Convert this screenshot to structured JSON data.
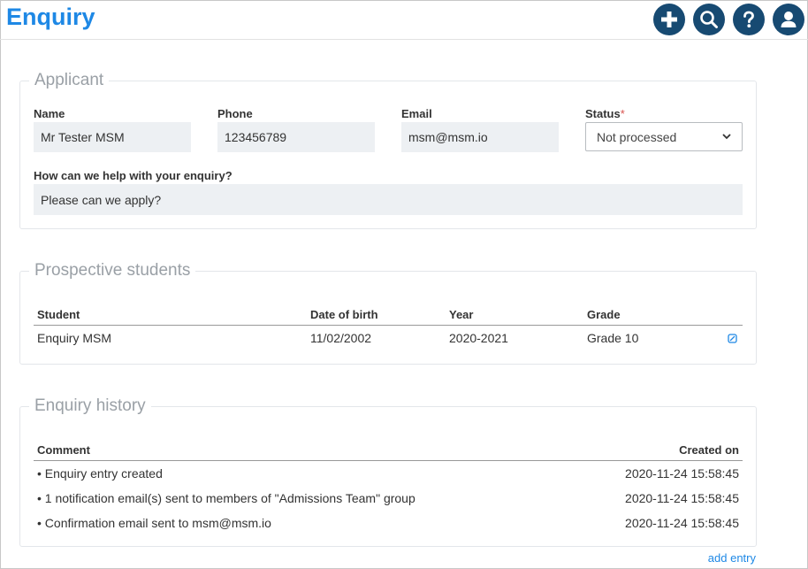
{
  "header": {
    "title": "Enquiry"
  },
  "toolbar": {
    "add": "add-icon",
    "search": "search-icon",
    "help": "help-icon",
    "user": "user-icon",
    "accent": "#174a72"
  },
  "applicant": {
    "section_title": "Applicant",
    "name_label": "Name",
    "name_value": "Mr Tester MSM",
    "phone_label": "Phone",
    "phone_value": "123456789",
    "email_label": "Email",
    "email_value": "msm@msm.io",
    "status_label": "Status",
    "status_required": "*",
    "status_value": "Not processed",
    "help_label": "How can we help with your enquiry?",
    "help_value": "Please can we apply?"
  },
  "students": {
    "section_title": "Prospective students",
    "columns": [
      "Student",
      "Date of birth",
      "Year",
      "Grade"
    ],
    "rows": [
      {
        "student": "Enquiry MSM",
        "dob": "11/02/2002",
        "year": "2020-2021",
        "grade": "Grade 10"
      }
    ]
  },
  "history": {
    "section_title": "Enquiry history",
    "col_comment": "Comment",
    "col_created": "Created on",
    "rows": [
      {
        "comment": "• Enquiry entry created",
        "created": "2020-11-24 15:58:45"
      },
      {
        "comment": "• 1 notification email(s) sent to members of \"Admissions Team\" group",
        "created": "2020-11-24 15:58:45"
      },
      {
        "comment": "• Confirmation email sent to msm@msm.io",
        "created": "2020-11-24 15:58:45"
      }
    ],
    "add_entry": "add entry"
  }
}
